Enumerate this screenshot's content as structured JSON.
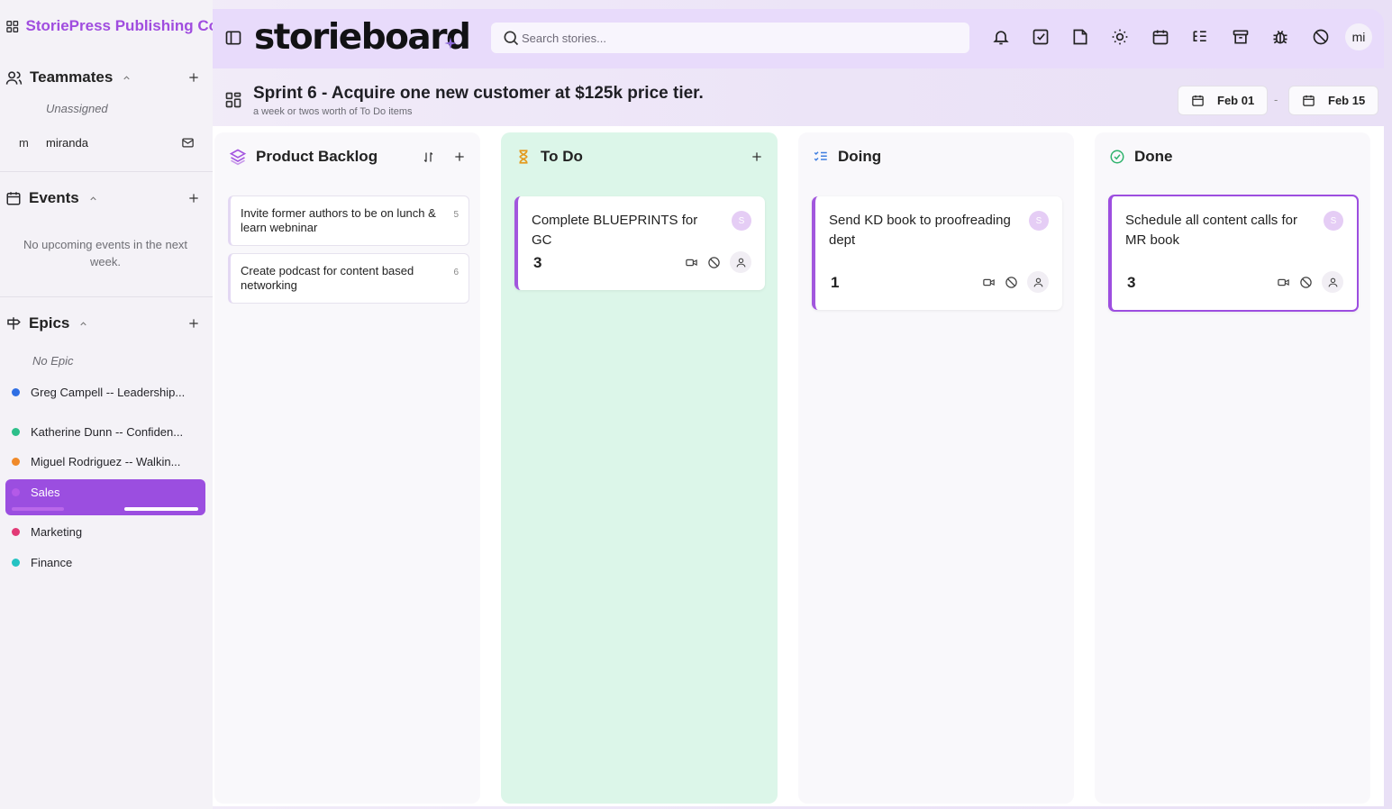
{
  "org": {
    "name": "StoriePress Publishing Co"
  },
  "sidebar": {
    "teammates": {
      "title": "Teammates",
      "unassigned_label": "Unassigned",
      "members": [
        {
          "initial": "m",
          "name": "miranda"
        }
      ]
    },
    "events": {
      "title": "Events",
      "empty_text": "No upcoming events in the next week."
    },
    "epics": {
      "title": "Epics",
      "no_epic_label": "No Epic",
      "items": [
        {
          "name": "Greg Campell -- Leadership...",
          "color": "#2f6fe4"
        },
        {
          "name": "Katherine Dunn -- Confiden...",
          "color": "#2dbf8a"
        },
        {
          "name": "Miguel Rodriguez -- Walkin...",
          "color": "#f08a2a"
        },
        {
          "name": "Sales",
          "color": "#b45ae8",
          "active": true
        },
        {
          "name": "Marketing",
          "color": "#e23a76"
        },
        {
          "name": "Finance",
          "color": "#25c3c3"
        }
      ]
    }
  },
  "header": {
    "logo": "storieboard",
    "search_placeholder": "Search stories...",
    "icons": [
      "bell-icon",
      "check-square-icon",
      "file-icon",
      "sun-icon",
      "calendar-icon",
      "list-tree-icon",
      "archive-icon",
      "bug-icon",
      "ban-icon"
    ],
    "user_initials": "mi"
  },
  "sprint": {
    "title": "Sprint 6 - Acquire one new customer at $125k price tier.",
    "subtitle": "a week or twos worth of To Do items",
    "start_date": "Feb 01",
    "separator": "-",
    "end_date": "Feb 15"
  },
  "board": {
    "columns": [
      {
        "id": "backlog",
        "title": "Product Backlog",
        "cards": [
          {
            "text": "Invite former authors to be on lunch & learn webninar",
            "number": "5"
          },
          {
            "text": "Create podcast for content based networking",
            "number": "6"
          }
        ]
      },
      {
        "id": "todo",
        "title": "To Do",
        "color": "#dcf6e9",
        "cards": [
          {
            "title": "Complete BLUEPRINTS for GC",
            "avatar": "S",
            "points": "3"
          }
        ]
      },
      {
        "id": "doing",
        "title": "Doing",
        "cards": [
          {
            "title": "Send KD book to proofreading dept",
            "avatar": "S",
            "points": "1"
          }
        ]
      },
      {
        "id": "done",
        "title": "Done",
        "cards": [
          {
            "title": "Schedule all content calls for MR book",
            "avatar": "S",
            "points": "3"
          }
        ]
      }
    ]
  }
}
